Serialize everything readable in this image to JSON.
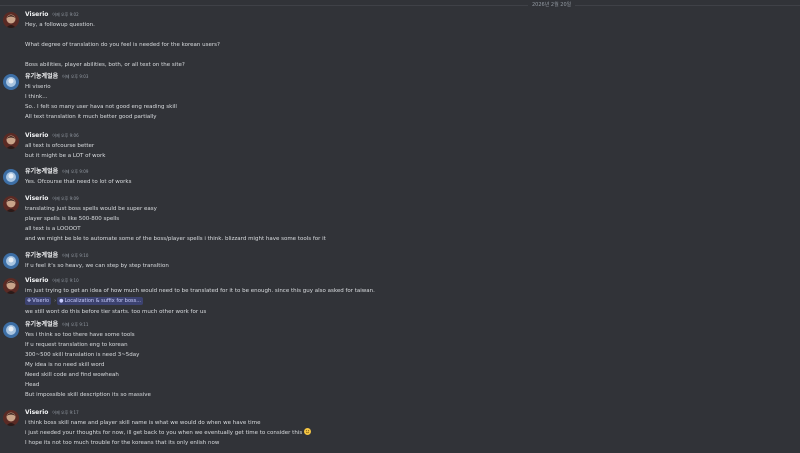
{
  "date_divider": "2026년 2월 20일",
  "messages": [
    {
      "author": "Viserio",
      "avatar": "viserio",
      "time": "어제 오후 9:02",
      "lines": [
        "Hey, a followup question.",
        "",
        "What degree of translation do you feel is needed for the korean users?",
        "",
        "Boss abilities, player abilities, both, or all text on the site?"
      ]
    },
    {
      "author": "유기농계얼음",
      "avatar": "korean",
      "time": "어제 오후 9:03",
      "lines": [
        "Hi viserio",
        "I think...",
        "So.. I felt so many user hava not good eng reading skill",
        "All text translation it much better good partially"
      ]
    },
    {
      "author": "Viserio",
      "avatar": "viserio",
      "time": "어제 오후 9:06",
      "lines": [
        "all text is ofcourse better",
        "but it might be a LOT of work"
      ]
    },
    {
      "author": "유기농계얼음",
      "avatar": "korean",
      "time": "어제 오후 9:09",
      "lines": [
        "Yes. Ofcourse that need to lot of works"
      ]
    },
    {
      "author": "Viserio",
      "avatar": "viserio",
      "time": "어제 오후 9:09",
      "lines": [
        "translating just boss spells would be super easy",
        "player spells is like 500-800 spells",
        "all text is a LOOOOT",
        "and we might be ble to automate some of the boss/player spells i think. blizzard might have some tools for it"
      ]
    },
    {
      "author": "유기농계얼음",
      "avatar": "korean",
      "time": "어제 오후 9:10",
      "lines": [
        "If u feel it's so heavy, we can step by step transltion"
      ]
    },
    {
      "author": "Viserio",
      "avatar": "viserio",
      "time": "어제 오후 9:10",
      "lines": [
        "im just trying to get an idea of how much would need to be translated for it to be enough. since this guy also asked for taiwan."
      ],
      "chip": {
        "user": "Viserio",
        "thread": "Localization & suffix for boss..."
      },
      "lines_after": [
        "we still wont do this before tier starts. too much other work for us"
      ]
    },
    {
      "author": "유기농계얼음",
      "avatar": "korean",
      "time": "어제 오후 9:11",
      "lines": [
        "Yes i think so too there have some tools",
        "If u request translation eng to korean",
        "300~500 skill translation is need 3~5day",
        "My idea is no need skill word",
        "Need skill code and find wowheah",
        "Head",
        "But impossible skill description its so massive"
      ]
    },
    {
      "author": "Viserio",
      "avatar": "viserio",
      "time": "어제 오후 9:17",
      "lines": [
        "i think boss skill name and player skill name is what we would do when we have time",
        "i just needed your thoughts for now, ill get back to you when we eventually get time to consider this",
        "I hope its not too much trouble for the koreans that its only enlish now"
      ],
      "emoji_line": 1
    }
  ]
}
